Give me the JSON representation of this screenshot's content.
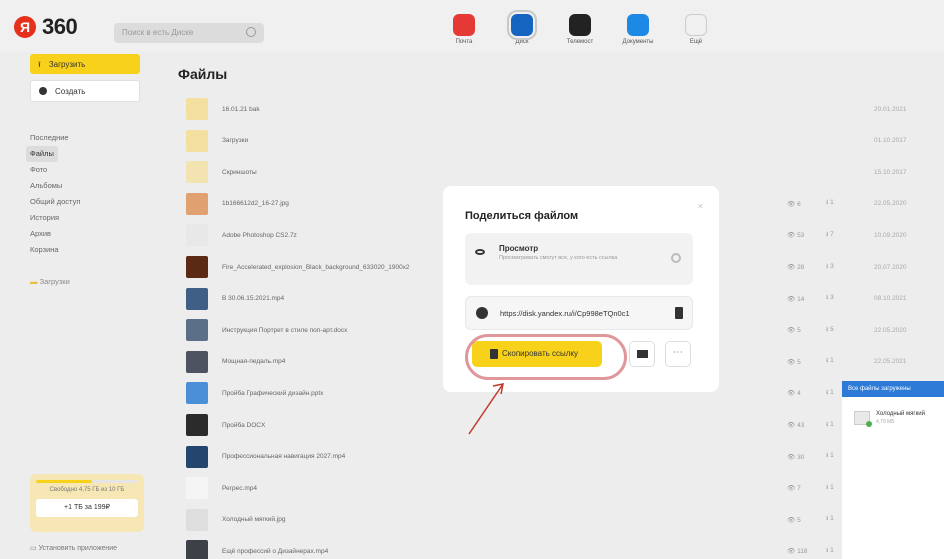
{
  "header": {
    "logo_mark": "Я",
    "logo_text": "360",
    "search_placeholder": "Поиск в есть Диске",
    "apps": [
      {
        "label": "Почта",
        "icon": "mail-app-icon",
        "color": "#e53935"
      },
      {
        "label": "Диск",
        "icon": "disk-app-icon",
        "color": "#1565c0"
      },
      {
        "label": "Телемост",
        "icon": "telemost-app-icon",
        "color": "#222222"
      },
      {
        "label": "Документы",
        "icon": "docs-app-icon",
        "color": "#1e88e5"
      },
      {
        "label": "Ещё",
        "icon": "more-apps-icon",
        "color": "#f0f0f0"
      }
    ]
  },
  "sidebar": {
    "upload_label": "Загрузить",
    "create_label": "Создать",
    "items": [
      "Последние",
      "Файлы",
      "Фото",
      "Альбомы",
      "Общий доступ",
      "История",
      "Архив",
      "Корзина"
    ],
    "downloads_label": "Загрузки",
    "free_space_text": "Свободно 4,75 ГБ из 10 ГБ",
    "free_space_fraction": 0.55,
    "buy_label": "+1 ТБ за 199₽",
    "install_label": "Установить приложение"
  },
  "main": {
    "title": "Файлы",
    "files": [
      {
        "name": "16.01.21 bak",
        "views": "",
        "downloads": "",
        "date": "20.01.2021",
        "thumb": "#f3dfa0"
      },
      {
        "name": "Загрузки",
        "views": "",
        "downloads": "",
        "date": "01.10.2017",
        "thumb": "#f3dfa0"
      },
      {
        "name": "Скриншоты",
        "views": "",
        "downloads": "",
        "date": "15.10.2017",
        "thumb": "#f3e3b0"
      },
      {
        "name": "1b166612d2_16-27.jpg",
        "views": "6",
        "downloads": "1",
        "date": "22.05.2020",
        "thumb": "#e0a070"
      },
      {
        "name": "Adobe Photoshop CS2.7z",
        "views": "53",
        "downloads": "7",
        "date": "10.09.2020",
        "thumb": "#e8e8e8"
      },
      {
        "name": "Fire_Accelerated_explosion_Black_background_633020_1900x2",
        "views": "28",
        "downloads": "3",
        "date": "20.07.2020",
        "thumb": "#5a2a14"
      },
      {
        "name": "В 30.06.15.2021.mp4",
        "views": "14",
        "downloads": "3",
        "date": "08.10.2021",
        "thumb": "#3f5f87"
      },
      {
        "name": "Инструкция Портрет в стиле поп-арт.docx",
        "views": "5",
        "downloads": "5",
        "date": "22.05.2020",
        "thumb": "#5c6f88"
      },
      {
        "name": "Мощная-педаль.mp4",
        "views": "5",
        "downloads": "1",
        "date": "22.05.2021",
        "thumb": "#4d5360"
      },
      {
        "name": "Пройба Графический дизайн.pptx",
        "views": "4",
        "downloads": "1",
        "date": "",
        "thumb": "#4b8fd8"
      },
      {
        "name": "Пройба DOCX",
        "views": "43",
        "downloads": "1",
        "date": "",
        "thumb": "#2b2b2b"
      },
      {
        "name": "Профессиональная навигация 2027.mp4",
        "views": "30",
        "downloads": "1",
        "date": "",
        "thumb": "#24466e"
      },
      {
        "name": "Регрес.mp4",
        "views": "7",
        "downloads": "1",
        "date": "",
        "thumb": "#f5f5f5"
      },
      {
        "name": "Холодный мягкий.jpg",
        "views": "5",
        "downloads": "1",
        "date": "",
        "thumb": "#dedede"
      },
      {
        "name": "Ещё профессий о Дизайнерах.mp4",
        "views": "118",
        "downloads": "1",
        "date": "",
        "thumb": "#3c4047"
      }
    ]
  },
  "modal": {
    "title": "Поделиться файлом",
    "access_label": "Просмотр",
    "access_desc": "Просматривать смогут все, у кого есть ссылка",
    "link_url": "https://disk.yandex.ru/i/Cp998eTQn0c1",
    "copy_label": "Скопировать ссылку",
    "accent": "#f8d21a"
  },
  "upload_panel": {
    "header": "Все файлы загружены",
    "item_name": "Холодный мягкий",
    "item_size": "4,79 МБ"
  }
}
